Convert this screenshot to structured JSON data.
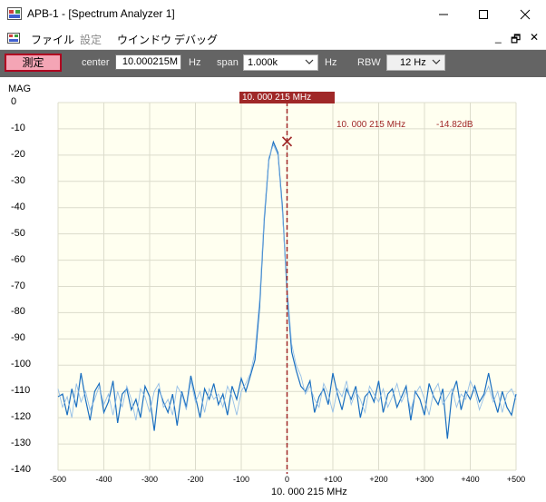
{
  "window": {
    "title": "APB-1 - [Spectrum Analyzer 1]",
    "controls": [
      "minimize-icon",
      "maximize-icon",
      "close-icon"
    ]
  },
  "menu": {
    "items": [
      {
        "label": "ファイル",
        "enabled": true
      },
      {
        "label": "設定",
        "enabled": false
      },
      {
        "label": "ウインドウ",
        "enabled": true
      },
      {
        "label": "デバッグ",
        "enabled": true
      }
    ],
    "mdi_controls": [
      "_",
      "🗗",
      "✕"
    ]
  },
  "toolbar": {
    "measure_label": "測定",
    "center_label": "center",
    "center_value": "10.000215M",
    "center_unit": "Hz",
    "span_label": "span",
    "span_value": "1.000k",
    "span_unit": "Hz",
    "rbw_label": "RBW",
    "rbw_value": "12 Hz"
  },
  "colors": {
    "toolbar_bg": "#646464",
    "plot_bg": "#fffff0",
    "marker": "#a02828",
    "trace": "#1a6fc0",
    "measure_bg": "#f4a5b5"
  },
  "chart_data": {
    "type": "line",
    "ylabel": "MAG",
    "xlabel": "10. 000 215 MHz",
    "x_ticks": [
      "-500",
      "-400",
      "-300",
      "-200",
      "-100",
      "0",
      "+100",
      "+200",
      "+300",
      "+400",
      "+500"
    ],
    "y_ticks": [
      "0",
      "-10",
      "-20",
      "-30",
      "-40",
      "-50",
      "-60",
      "-70",
      "-80",
      "-90",
      "-100",
      "-110",
      "-120",
      "-130",
      "-140"
    ],
    "xlim": [
      -500,
      500
    ],
    "ylim": [
      -140,
      0
    ],
    "grid": true,
    "marker": {
      "label": "10. 000 215 MHz",
      "freq": "10. 000 215 MHz",
      "level": "-14.82dB",
      "x": 0,
      "y": -14.82
    },
    "series": [
      {
        "role": "live",
        "x": [
          -500,
          -490,
          -480,
          -470,
          -460,
          -450,
          -440,
          -430,
          -420,
          -410,
          -400,
          -390,
          -380,
          -370,
          -360,
          -350,
          -340,
          -330,
          -320,
          -310,
          -300,
          -290,
          -280,
          -270,
          -260,
          -250,
          -240,
          -230,
          -220,
          -210,
          -200,
          -190,
          -180,
          -170,
          -160,
          -150,
          -140,
          -130,
          -120,
          -110,
          -100,
          -90,
          -80,
          -70,
          -60,
          -50,
          -40,
          -30,
          -20,
          -10,
          0,
          10,
          20,
          30,
          40,
          50,
          60,
          70,
          80,
          90,
          100,
          110,
          120,
          130,
          140,
          150,
          160,
          170,
          180,
          190,
          200,
          210,
          220,
          230,
          240,
          250,
          260,
          270,
          280,
          290,
          300,
          310,
          320,
          330,
          340,
          350,
          360,
          370,
          380,
          390,
          400,
          410,
          420,
          430,
          440,
          450,
          460,
          470,
          480,
          490,
          500
        ],
        "y": [
          -112,
          -111,
          -119,
          -109,
          -116,
          -103,
          -113,
          -121,
          -110,
          -107,
          -118,
          -114,
          -106,
          -122,
          -111,
          -109,
          -117,
          -113,
          -120,
          -108,
          -112,
          -125,
          -109,
          -114,
          -118,
          -111,
          -123,
          -110,
          -116,
          -104,
          -112,
          -120,
          -109,
          -113,
          -107,
          -115,
          -111,
          -119,
          -108,
          -113,
          -105,
          -110,
          -104,
          -98,
          -78,
          -45,
          -22,
          -15,
          -19,
          -40,
          -72,
          -95,
          -102,
          -108,
          -110,
          -106,
          -118,
          -112,
          -109,
          -115,
          -103,
          -111,
          -117,
          -109,
          -113,
          -108,
          -120,
          -112,
          -110,
          -114,
          -106,
          -118,
          -111,
          -109,
          -116,
          -112,
          -108,
          -121,
          -110,
          -113,
          -119,
          -107,
          -112,
          -115,
          -109,
          -128,
          -111,
          -106,
          -117,
          -110,
          -113,
          -108,
          -114,
          -111,
          -103,
          -112,
          -118,
          -110,
          -116,
          -119,
          -111
        ]
      },
      {
        "role": "previous",
        "x": [
          -500,
          -490,
          -480,
          -470,
          -460,
          -450,
          -440,
          -430,
          -420,
          -410,
          -400,
          -390,
          -380,
          -370,
          -360,
          -350,
          -340,
          -330,
          -320,
          -310,
          -300,
          -290,
          -280,
          -270,
          -260,
          -250,
          -240,
          -230,
          -220,
          -210,
          -200,
          -190,
          -180,
          -170,
          -160,
          -150,
          -140,
          -130,
          -120,
          -110,
          -100,
          -90,
          -80,
          -70,
          -60,
          -50,
          -40,
          -30,
          -20,
          -10,
          0,
          10,
          20,
          30,
          40,
          50,
          60,
          70,
          80,
          90,
          100,
          110,
          120,
          130,
          140,
          150,
          160,
          170,
          180,
          190,
          200,
          210,
          220,
          230,
          240,
          250,
          260,
          270,
          280,
          290,
          300,
          310,
          320,
          330,
          340,
          350,
          360,
          370,
          380,
          390,
          400,
          410,
          420,
          430,
          440,
          450,
          460,
          470,
          480,
          490,
          500
        ],
        "y": [
          -109,
          -116,
          -112,
          -120,
          -107,
          -114,
          -110,
          -117,
          -113,
          -108,
          -115,
          -111,
          -119,
          -110,
          -116,
          -108,
          -113,
          -121,
          -109,
          -112,
          -118,
          -110,
          -107,
          -116,
          -113,
          -119,
          -108,
          -111,
          -117,
          -106,
          -114,
          -110,
          -118,
          -109,
          -113,
          -111,
          -116,
          -108,
          -112,
          -119,
          -110,
          -107,
          -103,
          -95,
          -75,
          -43,
          -21,
          -16,
          -20,
          -42,
          -70,
          -92,
          -100,
          -104,
          -111,
          -108,
          -113,
          -116,
          -107,
          -111,
          -118,
          -109,
          -112,
          -106,
          -115,
          -110,
          -113,
          -118,
          -108,
          -111,
          -114,
          -109,
          -116,
          -112,
          -107,
          -114,
          -110,
          -117,
          -111,
          -108,
          -113,
          -119,
          -110,
          -107,
          -115,
          -112,
          -109,
          -116,
          -111,
          -113,
          -106,
          -110,
          -117,
          -112,
          -108,
          -114,
          -110,
          -118,
          -111,
          -109,
          -113
        ]
      }
    ]
  }
}
